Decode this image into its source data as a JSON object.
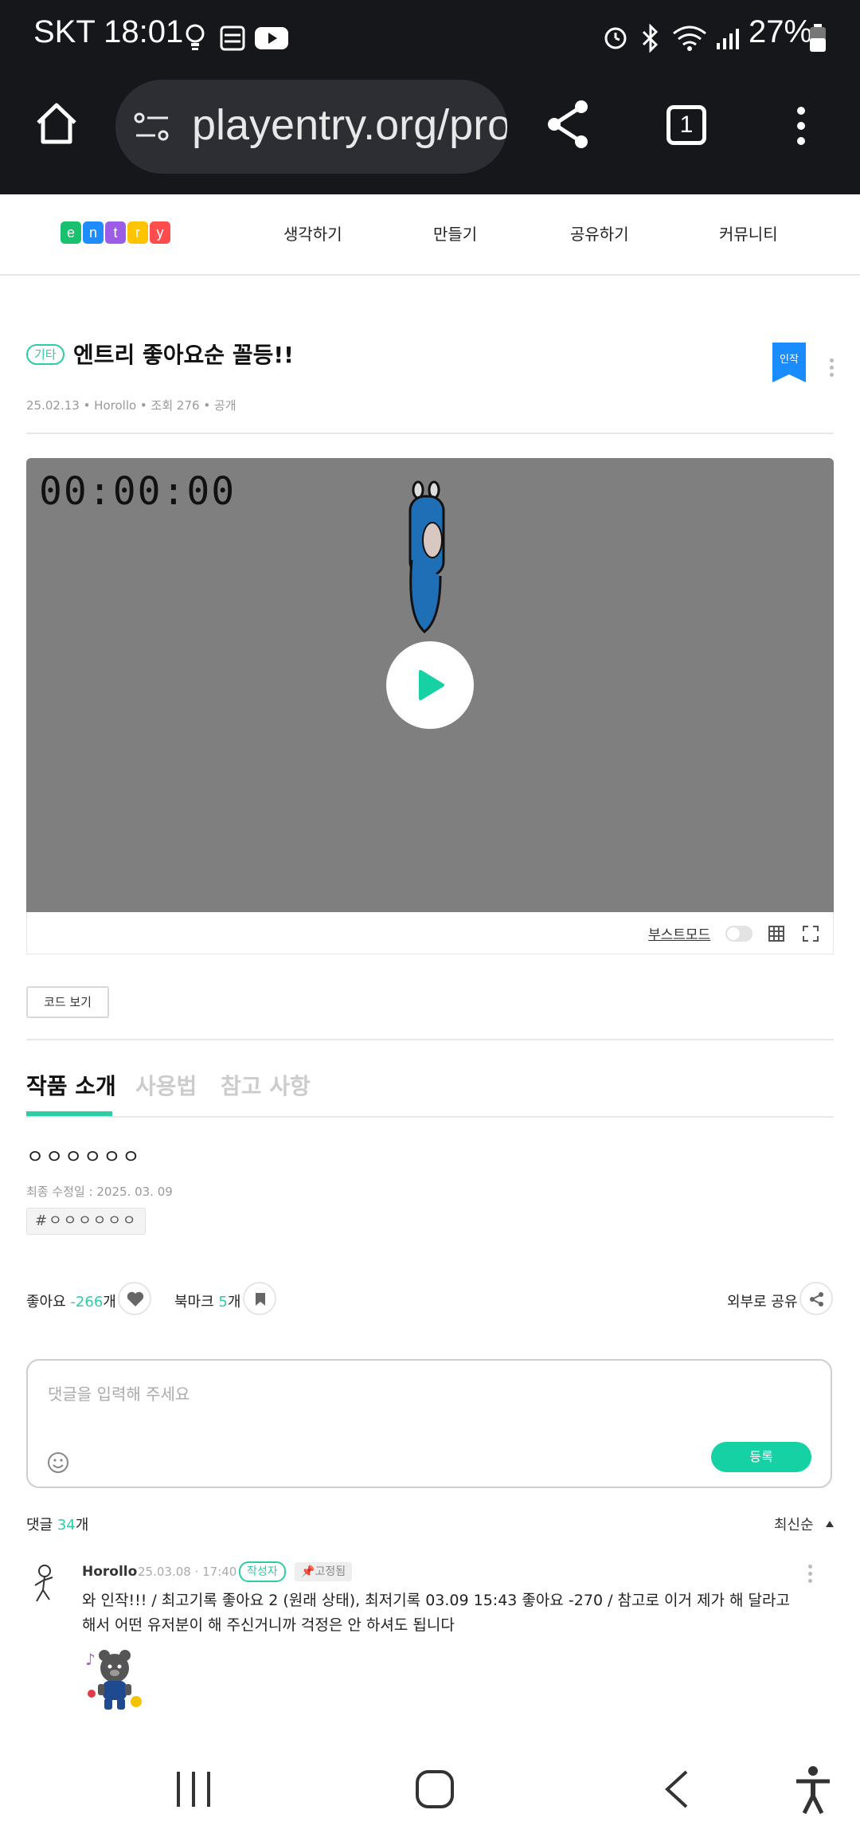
{
  "status_bar": {
    "carrier_time": "SKT 18:01",
    "battery": "27%"
  },
  "browser": {
    "url": "playentry.org/pro",
    "tab_count": "1"
  },
  "nav": {
    "logo_letters": [
      "e",
      "n",
      "t",
      "r",
      "y"
    ],
    "logo_colors": [
      "#19c16e",
      "#1e8cff",
      "#9b5de5",
      "#ffc400",
      "#ff4d4d"
    ],
    "items": [
      "생각하기",
      "만들기",
      "공유하기",
      "커뮤니티"
    ]
  },
  "project": {
    "category": "기타",
    "title": "엔트리 좋아요순 꼴등!!",
    "meta": "25.02.13 • Horollo • 조회 276 • 공개",
    "flag": "인작"
  },
  "player": {
    "timer": "00:00:00",
    "boost_mode_label": "부스트모드"
  },
  "code_button": "코드 보기",
  "tabs": [
    "작품 소개",
    "사용법",
    "참고 사항"
  ],
  "description": {
    "text": "ㅇㅇㅇㅇㅇㅇ",
    "last_modified": "최종 수정일 : 2025. 03. 09",
    "hashtag": "#ㅇㅇㅇㅇㅇㅇ"
  },
  "social": {
    "like_label": "좋아요",
    "like_count": "-266",
    "bookmark_label": "북마크",
    "bookmark_count": "5",
    "unit": "개",
    "share_label": "외부로 공유"
  },
  "comment_input": {
    "placeholder": "댓글을 입력해 주세요",
    "submit_label": "등록"
  },
  "comments_header": {
    "label": "댓글",
    "count": "34",
    "unit": "개",
    "sort": "최신순"
  },
  "comment": {
    "author": "Horollo",
    "date": "25.03.08 · 17:40",
    "author_badge": "작성자",
    "pinned_badge": "고정됨",
    "text": "와 인작!!! / 최고기록 좋아요 2 (원래 상태), 최저기록 03.09 15:43 좋아요 -270 / 참고로 이거 제가 해 달라고 해서 어떤 유저분이 해 주신거니까 걱정은 안 하셔도 됩니다"
  },
  "colors": {
    "accent": "#2dcea5",
    "dark_bar": "#16171b",
    "stage": "#7f7f7f"
  }
}
